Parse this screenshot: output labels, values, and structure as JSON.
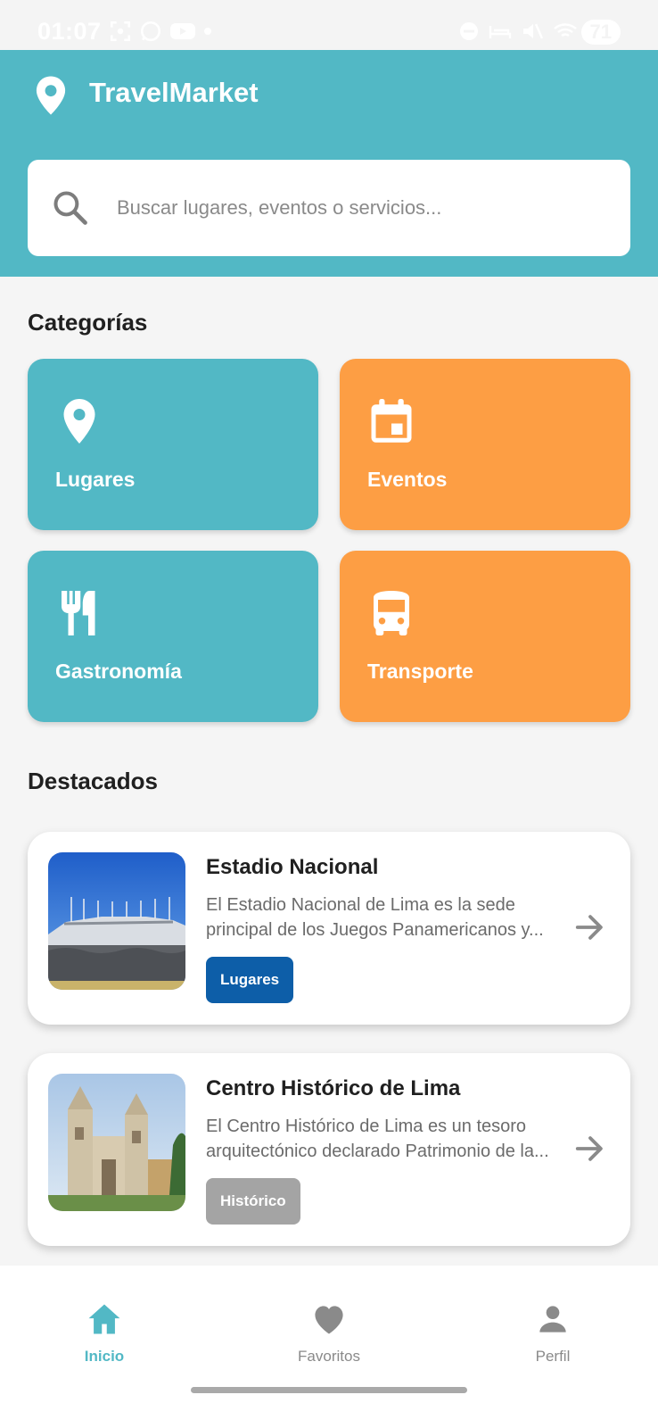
{
  "status_bar": {
    "time": "01:07",
    "battery": "71"
  },
  "header": {
    "title": "TravelMarket"
  },
  "search": {
    "placeholder": "Buscar lugares, eventos o servicios..."
  },
  "categories": {
    "title": "Categorías",
    "items": [
      {
        "label": "Lugares",
        "icon": "map-pin-icon",
        "color": "#52b8c5"
      },
      {
        "label": "Eventos",
        "icon": "calendar-icon",
        "color": "#fd9e44"
      },
      {
        "label": "Gastronomía",
        "icon": "fork-knife-icon",
        "color": "#52b8c5"
      },
      {
        "label": "Transporte",
        "icon": "bus-icon",
        "color": "#fd9e44"
      }
    ]
  },
  "featured": {
    "title": "Destacados",
    "items": [
      {
        "title": "Estadio Nacional",
        "desc_line1": "El Estadio Nacional de Lima es la sede",
        "desc_line2": "principal de los Juegos Panamericanos y...",
        "tag": "Lugares",
        "tag_color": "#0d5ea8"
      },
      {
        "title": "Centro Histórico de Lima",
        "desc_line1": "El Centro Histórico de Lima es un tesoro",
        "desc_line2": "arquitectónico declarado Patrimonio de la...",
        "tag": "Histórico",
        "tag_color": "#a4a4a4"
      }
    ]
  },
  "bottom_nav": {
    "items": [
      {
        "label": "Inicio",
        "icon": "home-icon",
        "active": true
      },
      {
        "label": "Favoritos",
        "icon": "heart-icon",
        "active": false
      },
      {
        "label": "Perfil",
        "icon": "person-icon",
        "active": false
      }
    ]
  },
  "colors": {
    "primary": "#52b8c5",
    "accent": "#fd9e44",
    "tag_blue": "#0d5ea8"
  }
}
